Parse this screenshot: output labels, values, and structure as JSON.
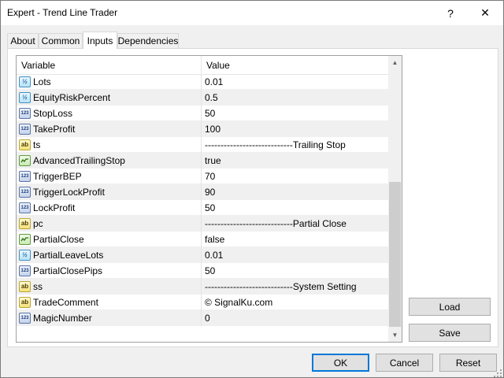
{
  "window": {
    "title": "Expert - Trend Line Trader",
    "help_label": "?",
    "close_label": "✕"
  },
  "tabs": [
    {
      "label": "About"
    },
    {
      "label": "Common"
    },
    {
      "label": "Inputs",
      "active": true
    },
    {
      "label": "Dependencies"
    }
  ],
  "grid": {
    "headers": {
      "variable": "Variable",
      "value": "Value"
    },
    "rows": [
      {
        "type": "double",
        "icon": "double-type-icon",
        "icon_text": "½",
        "name": "Lots",
        "value": "0.01"
      },
      {
        "type": "double",
        "icon": "double-type-icon",
        "icon_text": "½",
        "name": "EquityRiskPercent",
        "value": "0.5"
      },
      {
        "type": "int",
        "icon": "integer-type-icon",
        "icon_text": "123",
        "name": "StopLoss",
        "value": "50"
      },
      {
        "type": "int",
        "icon": "integer-type-icon",
        "icon_text": "123",
        "name": "TakeProfit",
        "value": "100"
      },
      {
        "type": "string",
        "icon": "string-type-icon",
        "icon_text": "ab",
        "name": "ts",
        "value": "----------------------------Trailing Stop"
      },
      {
        "type": "bool",
        "icon": "boolean-type-icon",
        "icon_text": "",
        "name": "AdvancedTrailingStop",
        "value": "true"
      },
      {
        "type": "int",
        "icon": "integer-type-icon",
        "icon_text": "123",
        "name": "TriggerBEP",
        "value": "70"
      },
      {
        "type": "int",
        "icon": "integer-type-icon",
        "icon_text": "123",
        "name": "TriggerLockProfit",
        "value": "90"
      },
      {
        "type": "int",
        "icon": "integer-type-icon",
        "icon_text": "123",
        "name": "LockProfit",
        "value": "50"
      },
      {
        "type": "string",
        "icon": "string-type-icon",
        "icon_text": "ab",
        "name": "pc",
        "value": "----------------------------Partial Close"
      },
      {
        "type": "bool",
        "icon": "boolean-type-icon",
        "icon_text": "",
        "name": "PartialClose",
        "value": "false"
      },
      {
        "type": "double",
        "icon": "double-type-icon",
        "icon_text": "½",
        "name": "PartialLeaveLots",
        "value": "0.01"
      },
      {
        "type": "int",
        "icon": "integer-type-icon",
        "icon_text": "123",
        "name": "PartialClosePips",
        "value": "50"
      },
      {
        "type": "string",
        "icon": "string-type-icon",
        "icon_text": "ab",
        "name": "ss",
        "value": "----------------------------System Setting"
      },
      {
        "type": "string",
        "icon": "string-type-icon",
        "icon_text": "ab",
        "name": "TradeComment",
        "value": "© SignalKu.com"
      },
      {
        "type": "int",
        "icon": "integer-type-icon",
        "icon_text": "123",
        "name": "MagicNumber",
        "value": "0"
      }
    ]
  },
  "scrollbar": {
    "up_glyph": "▲",
    "down_glyph": "▼"
  },
  "side_buttons": {
    "load_label": "Load",
    "save_label": "Save"
  },
  "footer": {
    "ok_label": "OK",
    "cancel_label": "Cancel",
    "reset_label": "Reset"
  }
}
